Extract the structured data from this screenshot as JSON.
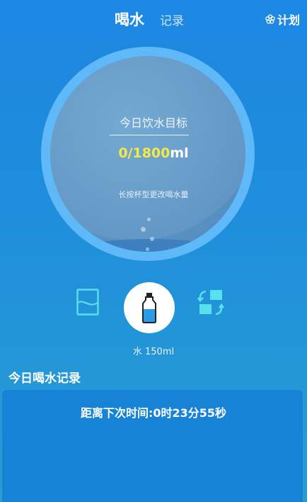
{
  "header": {
    "tab_active": "喝水",
    "tab_inactive": "记录",
    "plan_label": "计划",
    "plan_icon": "flower-icon"
  },
  "goal": {
    "title": "今日饮水目标",
    "current": "0/",
    "target": "1800",
    "unit": "ml",
    "hint": "长按杯型更改喝水量"
  },
  "cups": {
    "left_icon": "glass-icon",
    "center_icon": "water-bottle-icon",
    "right_icon": "swap-icon",
    "selected_label": "水 150ml"
  },
  "records": {
    "title": "今日喝水记录",
    "countdown": "距离下次时间:0时23分55秒"
  },
  "colors": {
    "header_bg": "#1e88e5",
    "ring": "#5fb8f7",
    "highlight_yellow": "#f4ea46",
    "icon_cyan": "#57e0ee"
  }
}
